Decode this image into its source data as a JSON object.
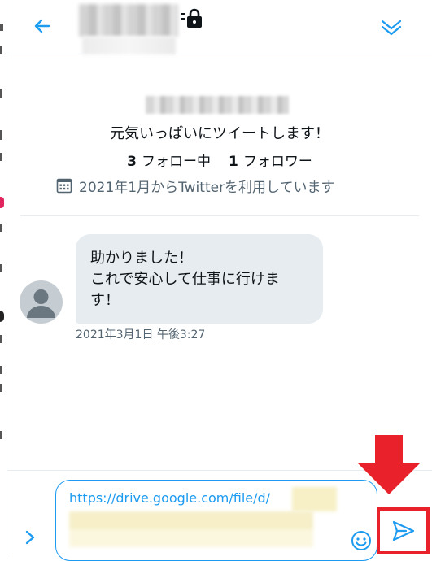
{
  "header": {
    "back_icon": "arrow-left-icon",
    "lock_icon": "lock-icon",
    "collapse_icon": "chevron-double-down-icon"
  },
  "profile": {
    "bio": "元気いっぱいにツイートします！",
    "following_count": "3",
    "following_label": "フォロー中",
    "followers_count": "1",
    "followers_label": "フォロワー",
    "joined_text": "2021年1月からTwitterを利用しています",
    "calendar_icon": "calendar-icon"
  },
  "message": {
    "lines": [
      "助かりました！",
      "これで安心して仕事に行けま",
      "す！"
    ],
    "timestamp": "2021年3月1日 午後3:27",
    "avatar_icon": "default-avatar-icon"
  },
  "composer": {
    "input_value": "https://drive.google.com/file/d/",
    "expand_icon": "chevron-right-icon",
    "emoji_icon": "emoji-icon",
    "send_icon": "send-icon"
  },
  "colors": {
    "accent": "#1d9bf0",
    "bubble": "#e6ecf0",
    "highlight": "#e8212b",
    "secondary_text": "#536471"
  }
}
